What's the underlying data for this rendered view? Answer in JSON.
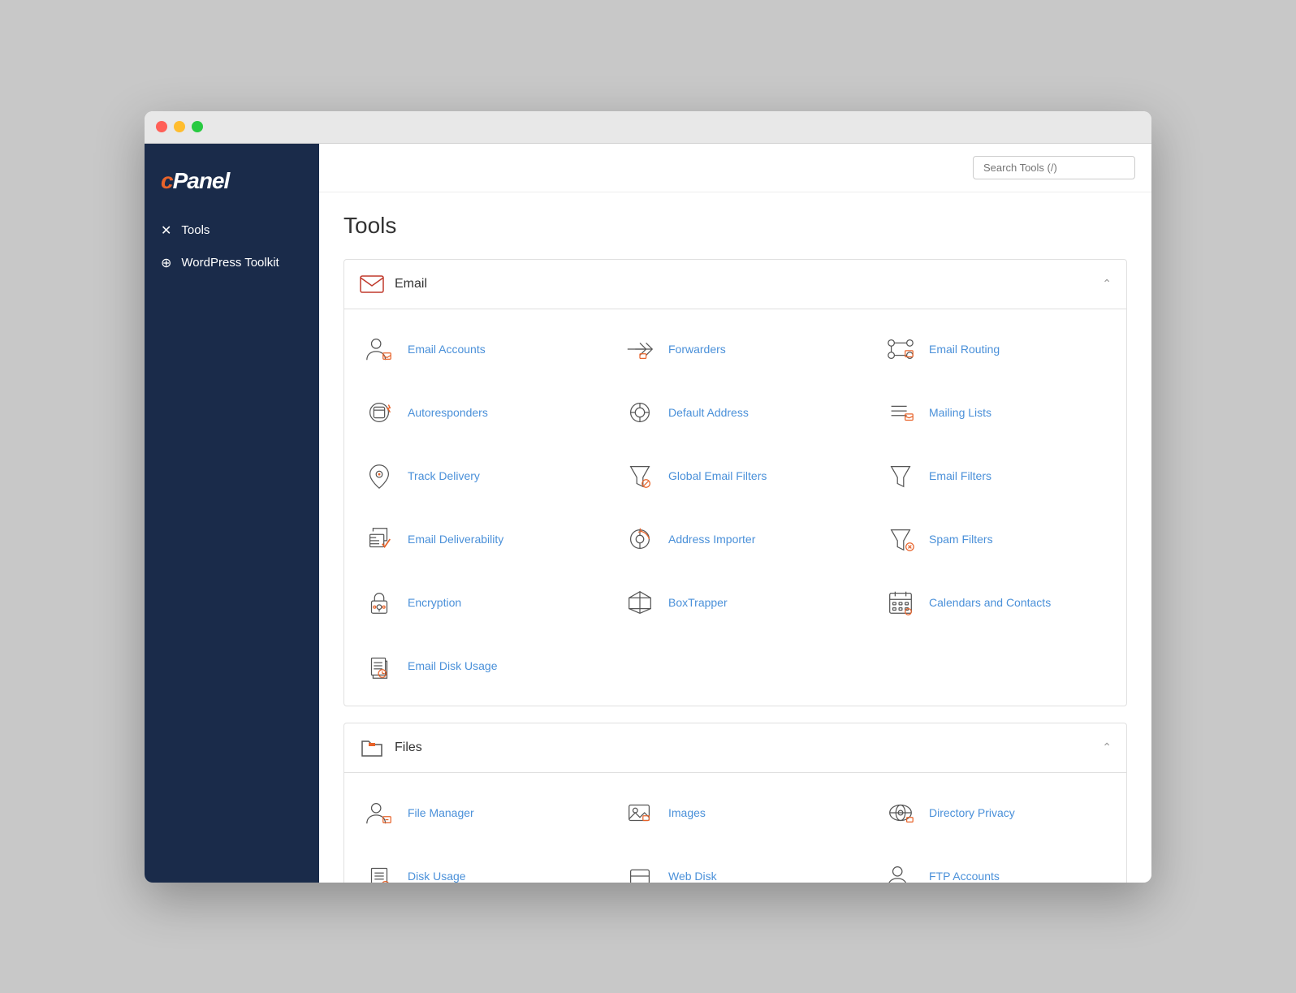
{
  "window": {
    "title": "cPanel"
  },
  "logo": {
    "text_c": "c",
    "text_panel": "Panel"
  },
  "sidebar": {
    "items": [
      {
        "id": "tools",
        "label": "Tools",
        "icon": "wrench"
      },
      {
        "id": "wordpress-toolkit",
        "label": "WordPress Toolkit",
        "icon": "wordpress"
      }
    ]
  },
  "header": {
    "search_placeholder": "Search Tools (/)"
  },
  "page": {
    "title": "Tools"
  },
  "sections": [
    {
      "id": "email",
      "label": "Email",
      "tools": [
        {
          "id": "email-accounts",
          "label": "Email Accounts"
        },
        {
          "id": "forwarders",
          "label": "Forwarders"
        },
        {
          "id": "email-routing",
          "label": "Email Routing"
        },
        {
          "id": "autoresponders",
          "label": "Autoresponders"
        },
        {
          "id": "default-address",
          "label": "Default Address"
        },
        {
          "id": "mailing-lists",
          "label": "Mailing Lists"
        },
        {
          "id": "track-delivery",
          "label": "Track Delivery"
        },
        {
          "id": "global-email-filters",
          "label": "Global Email Filters"
        },
        {
          "id": "email-filters",
          "label": "Email Filters"
        },
        {
          "id": "email-deliverability",
          "label": "Email Deliverability"
        },
        {
          "id": "address-importer",
          "label": "Address Importer"
        },
        {
          "id": "spam-filters",
          "label": "Spam Filters"
        },
        {
          "id": "encryption",
          "label": "Encryption"
        },
        {
          "id": "boxtrapper",
          "label": "BoxTrapper"
        },
        {
          "id": "calendars-and-contacts",
          "label": "Calendars and Contacts"
        },
        {
          "id": "email-disk-usage",
          "label": "Email Disk Usage"
        }
      ]
    },
    {
      "id": "files",
      "label": "Files",
      "tools": [
        {
          "id": "file-manager",
          "label": "File Manager"
        },
        {
          "id": "images",
          "label": "Images"
        },
        {
          "id": "directory-privacy",
          "label": "Directory Privacy"
        },
        {
          "id": "disk-usage",
          "label": "Disk Usage"
        },
        {
          "id": "web-disk",
          "label": "Web Disk"
        },
        {
          "id": "ftp-accounts",
          "label": "FTP Accounts"
        }
      ]
    }
  ]
}
